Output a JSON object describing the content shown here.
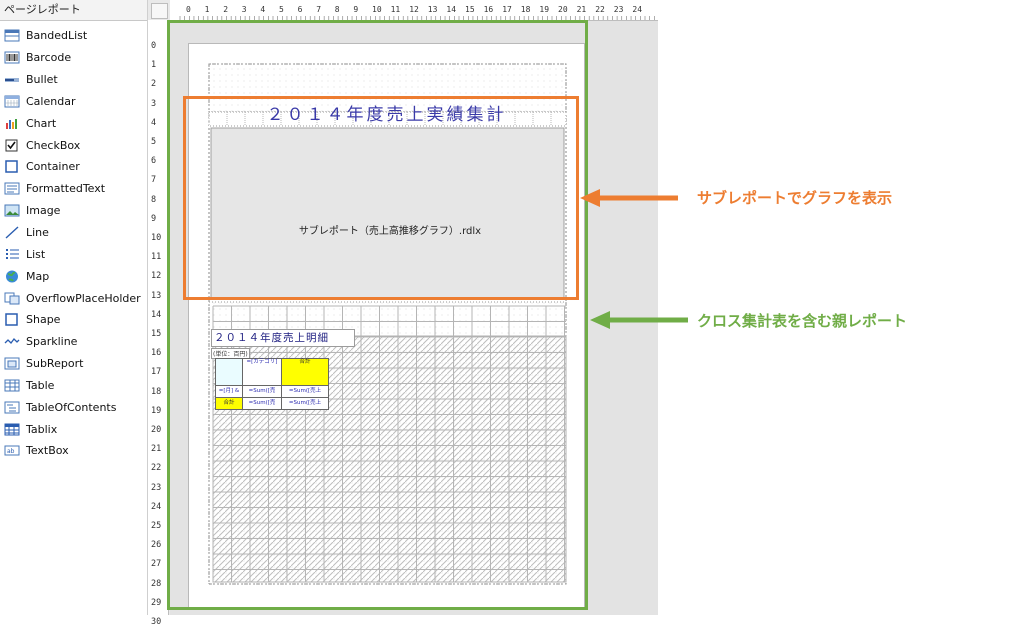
{
  "toolbox": {
    "title": "ページレポート",
    "items": [
      {
        "label": "BandedList",
        "icon": "banded-list-icon"
      },
      {
        "label": "Barcode",
        "icon": "barcode-icon"
      },
      {
        "label": "Bullet",
        "icon": "bullet-icon"
      },
      {
        "label": "Calendar",
        "icon": "calendar-icon"
      },
      {
        "label": "Chart",
        "icon": "chart-icon"
      },
      {
        "label": "CheckBox",
        "icon": "checkbox-icon"
      },
      {
        "label": "Container",
        "icon": "container-icon"
      },
      {
        "label": "FormattedText",
        "icon": "formatted-text-icon"
      },
      {
        "label": "Image",
        "icon": "image-icon"
      },
      {
        "label": "Line",
        "icon": "line-icon"
      },
      {
        "label": "List",
        "icon": "list-icon"
      },
      {
        "label": "Map",
        "icon": "map-icon"
      },
      {
        "label": "OverflowPlaceHolder",
        "icon": "overflow-placeholder-icon"
      },
      {
        "label": "Shape",
        "icon": "shape-icon"
      },
      {
        "label": "Sparkline",
        "icon": "sparkline-icon"
      },
      {
        "label": "SubReport",
        "icon": "subreport-icon"
      },
      {
        "label": "Table",
        "icon": "table-icon"
      },
      {
        "label": "TableOfContents",
        "icon": "table-of-contents-icon"
      },
      {
        "label": "Tablix",
        "icon": "tablix-icon"
      },
      {
        "label": "TextBox",
        "icon": "textbox-icon"
      }
    ]
  },
  "rulers": {
    "horizontal": [
      "0",
      "1",
      "2",
      "3",
      "4",
      "5",
      "6",
      "7",
      "8",
      "9",
      "10",
      "11",
      "12",
      "13",
      "14",
      "15",
      "16",
      "17",
      "18",
      "19",
      "20",
      "21",
      "22",
      "23",
      "24"
    ],
    "vertical": [
      "0",
      "1",
      "2",
      "3",
      "4",
      "5",
      "6",
      "7",
      "8",
      "9",
      "10",
      "11",
      "12",
      "13",
      "14",
      "15",
      "16",
      "17",
      "18",
      "19",
      "20",
      "21",
      "22",
      "23",
      "24",
      "25",
      "26",
      "27",
      "28",
      "29",
      "30"
    ]
  },
  "report": {
    "title": "２０１４年度売上実績集計",
    "subreport_label": "サブレポート（売上高推移グラフ）.rdlx",
    "detail_title": "２０１４年度売上明細",
    "unit_label": "(単位：百円)",
    "tablix": {
      "header": [
        "",
        "=[カテゴリ]",
        "合計"
      ],
      "data_row": [
        "=[月] &",
        "=Sum([売",
        "=Sum([売上"
      ],
      "total_row": [
        "合計",
        "=Sum([売",
        "=Sum([売上"
      ]
    }
  },
  "annotations": {
    "subreport_note": "サブレポートでグラフを表示",
    "parent_note": "クロス集計表を含む親レポート"
  },
  "colors": {
    "orange": "#ed7d31",
    "green": "#70ad47",
    "title_blue": "#3a3aa8",
    "highlight_yellow": "#ffff00"
  }
}
